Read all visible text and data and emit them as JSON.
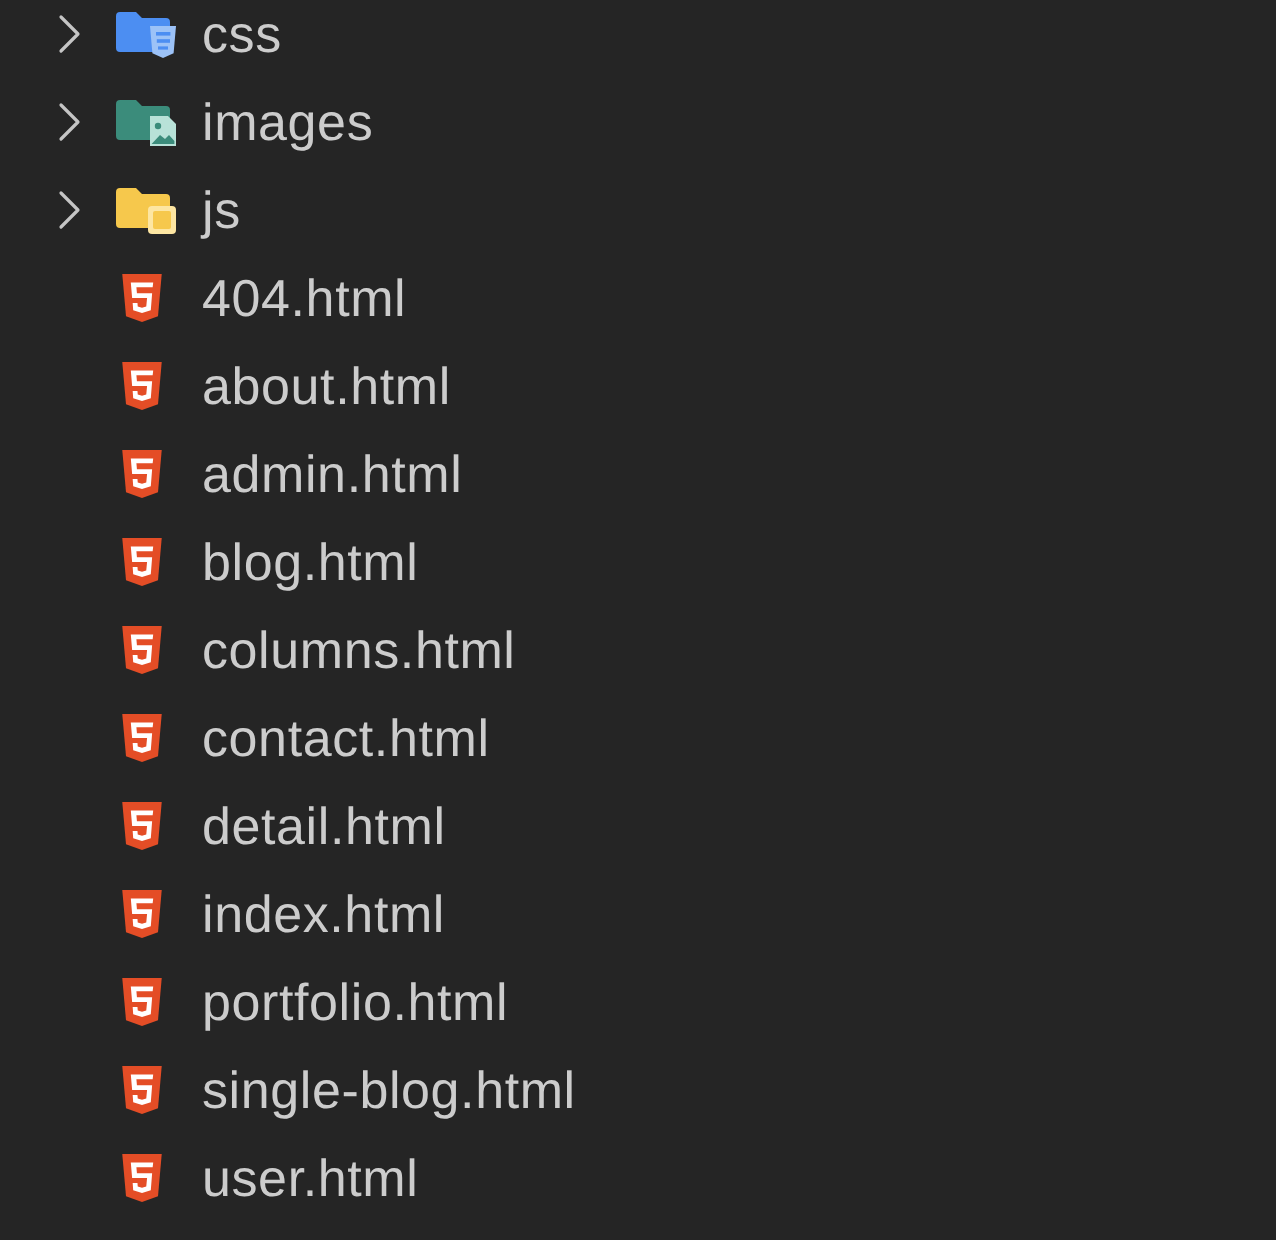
{
  "explorer": {
    "folders": [
      {
        "name": "css",
        "kind": "css_folder",
        "expanded": false
      },
      {
        "name": "images",
        "kind": "image_folder",
        "expanded": false
      },
      {
        "name": "js",
        "kind": "js_folder",
        "expanded": false
      }
    ],
    "files": [
      {
        "name": "404.html"
      },
      {
        "name": "about.html"
      },
      {
        "name": "admin.html"
      },
      {
        "name": "blog.html"
      },
      {
        "name": "columns.html"
      },
      {
        "name": "contact.html"
      },
      {
        "name": "detail.html"
      },
      {
        "name": "index.html"
      },
      {
        "name": "portfolio.html"
      },
      {
        "name": "single-blog.html"
      },
      {
        "name": "user.html"
      }
    ]
  }
}
